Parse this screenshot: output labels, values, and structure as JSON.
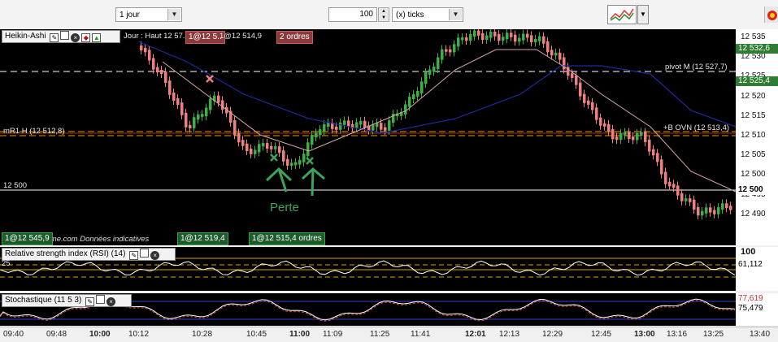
{
  "toolbar": {
    "period": "1 jour",
    "units_value": "100",
    "units_type": "(x) ticks"
  },
  "main_chart": {
    "title": "Heikin-Ashi",
    "header_info": "Jour : Haut 12 57..",
    "overlay_info": "1@12 514,9",
    "order_tags": [
      {
        "text": "1@12 5..",
        "kind": "red"
      },
      {
        "text": "2 ordres",
        "kind": "red"
      }
    ],
    "line_labels": {
      "pivot": "pivot M (12 527,7)",
      "ovn": "+B OVN (12 513,4)",
      "h_label": "mR1 H (12 512,8)",
      "level": "12 500"
    },
    "annotation_text": "Perte",
    "watermark": "© ProRealTime.com  Données indicatives",
    "bottom_tags": [
      {
        "text": "1@12 545,9",
        "kind": "green"
      },
      {
        "text": "1@12 519,4",
        "kind": "green"
      },
      {
        "text": "1@12 515,4 ordres",
        "kind": "green"
      }
    ],
    "price_axis": [
      "12 535",
      "12 530",
      "12 525",
      "12 520",
      "12 515",
      "12 510",
      "12 505",
      "12 500",
      "12 495",
      "12 490"
    ],
    "price_boxes": [
      {
        "text": "12 532,6",
        "color": "#2e7d32"
      },
      {
        "text": "12 525,4",
        "color": "#2e7d32"
      }
    ],
    "colors": {
      "bull": "#3cb043",
      "bear": "#f08080",
      "ma_blue": "#1e2a9a",
      "ma_pink": "#d9a6a6"
    }
  },
  "rsi": {
    "title": "Relative strength index (RSI) (14)",
    "axis_top": "100",
    "value": "61,112",
    "left_level": "25"
  },
  "stoch": {
    "title": "Stochastique (11 5 3)",
    "value_top": "77,619",
    "value": "75,479"
  },
  "time_axis": [
    {
      "t": "09:40",
      "bold": false
    },
    {
      "t": "09:48",
      "bold": false
    },
    {
      "t": "10:00",
      "bold": true
    },
    {
      "t": "10:12",
      "bold": false
    },
    {
      "t": "10:28",
      "bold": false
    },
    {
      "t": "10:45",
      "bold": false
    },
    {
      "t": "11:00",
      "bold": true
    },
    {
      "t": "11:09",
      "bold": false
    },
    {
      "t": "11:25",
      "bold": false
    },
    {
      "t": "11:41",
      "bold": false
    },
    {
      "t": "12:01",
      "bold": true
    },
    {
      "t": "12:13",
      "bold": false
    },
    {
      "t": "12:29",
      "bold": false
    },
    {
      "t": "12:45",
      "bold": false
    },
    {
      "t": "13:00",
      "bold": true
    },
    {
      "t": "13:16",
      "bold": false
    },
    {
      "t": "13:25",
      "bold": false
    },
    {
      "t": "13:40",
      "bold": false
    }
  ]
}
